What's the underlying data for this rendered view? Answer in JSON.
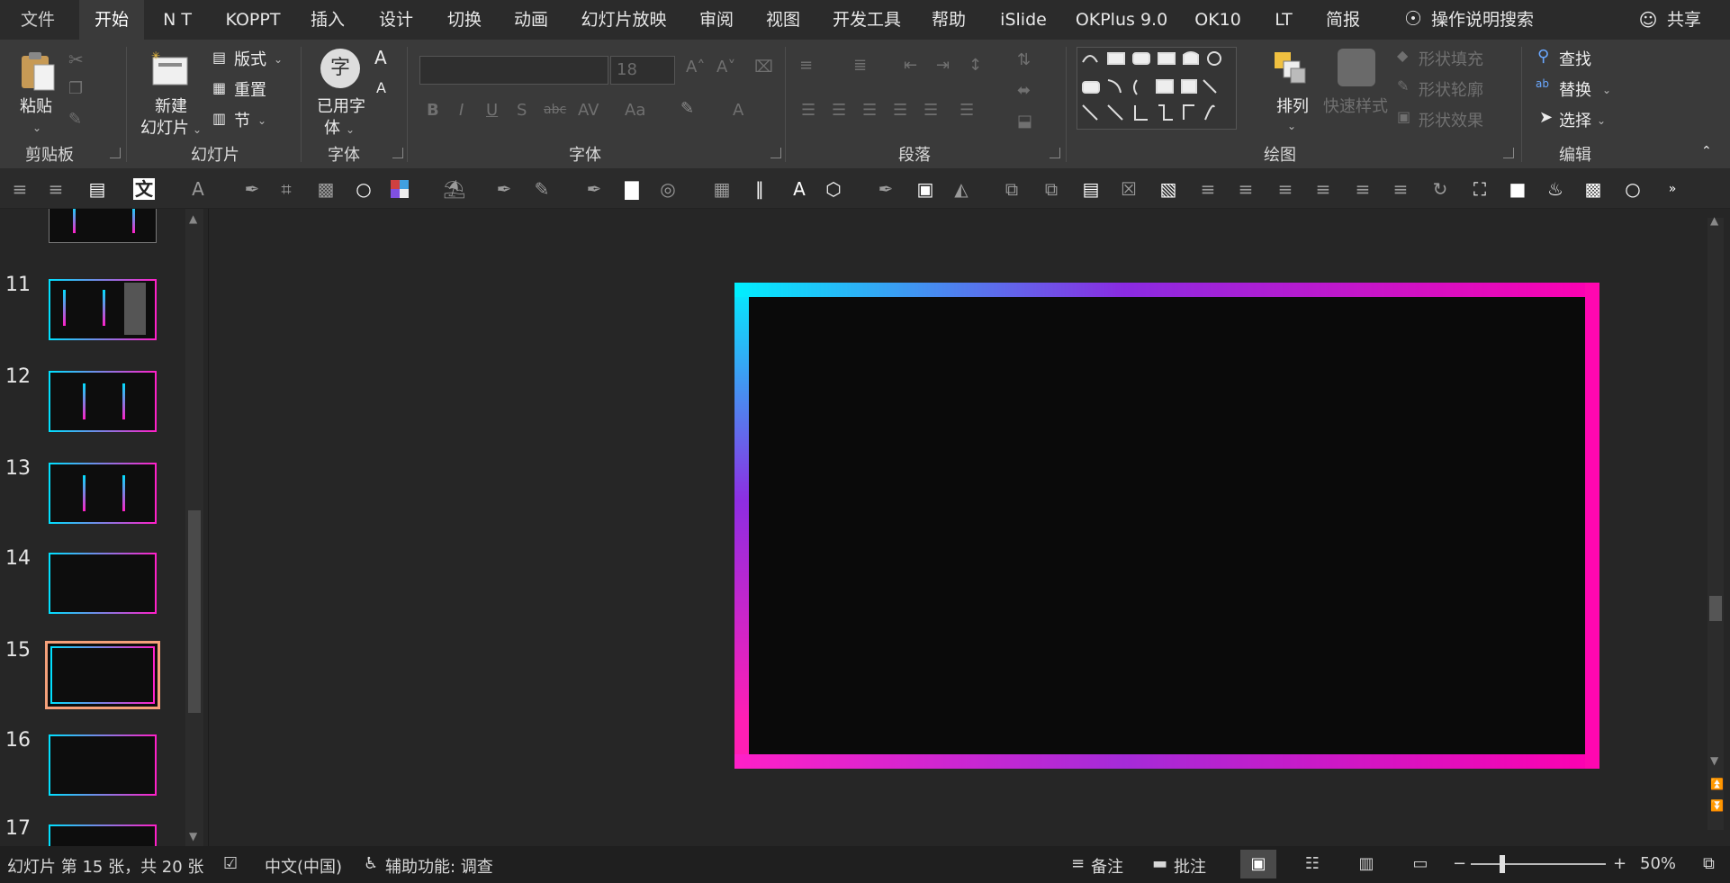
{
  "tabs": [
    "文件",
    "开始",
    "N T",
    "KOPPT",
    "插入",
    "设计",
    "切换",
    "动画",
    "幻灯片放映",
    "审阅",
    "视图",
    "开发工具",
    "帮助",
    "iSlide",
    "OKPlus 9.0",
    "OK10",
    "LT",
    "简报"
  ],
  "active_tab": "开始",
  "search_label": "操作说明搜索",
  "share_label": "共享",
  "ribbon": {
    "clipboard": {
      "paste": "粘贴",
      "label": "剪贴板"
    },
    "slides": {
      "new_slide_line1": "新建",
      "new_slide_line2": "幻灯片",
      "layout": "版式",
      "reset": "重置",
      "section": "节",
      "label": "幻灯片"
    },
    "fonts": {
      "used_fonts_line1": "已用字",
      "used_fonts_line2": "体",
      "label": "字体",
      "glyph": "字"
    },
    "font": {
      "size": "18",
      "label": "字体",
      "aa": "Aa"
    },
    "paragraph": {
      "label": "段落"
    },
    "drawing": {
      "arrange": "排列",
      "quick_styles": "快速样式",
      "shape_fill": "形状填充",
      "shape_outline": "形状轮廓",
      "shape_effects": "形状效果",
      "label": "绘图"
    },
    "editing": {
      "find": "查找",
      "replace": "替换",
      "select": "选择",
      "label": "编辑"
    }
  },
  "thumbnails": [
    {
      "num": "11"
    },
    {
      "num": "12"
    },
    {
      "num": "13"
    },
    {
      "num": "14"
    },
    {
      "num": "15"
    },
    {
      "num": "16"
    },
    {
      "num": "17"
    }
  ],
  "selected_slide": "15",
  "status": {
    "slide_info": "幻灯片 第 15 张，共 20 张",
    "language": "中文(中国)",
    "accessibility": "辅助功能: 调查",
    "notes": "备注",
    "comments": "批注",
    "zoom": "50%"
  },
  "colors": {
    "border_cyan": "#00f0ff",
    "border_purple": "#8a2be2",
    "border_pink": "#ff00b0",
    "selected_thumb": "#f4a07a"
  }
}
